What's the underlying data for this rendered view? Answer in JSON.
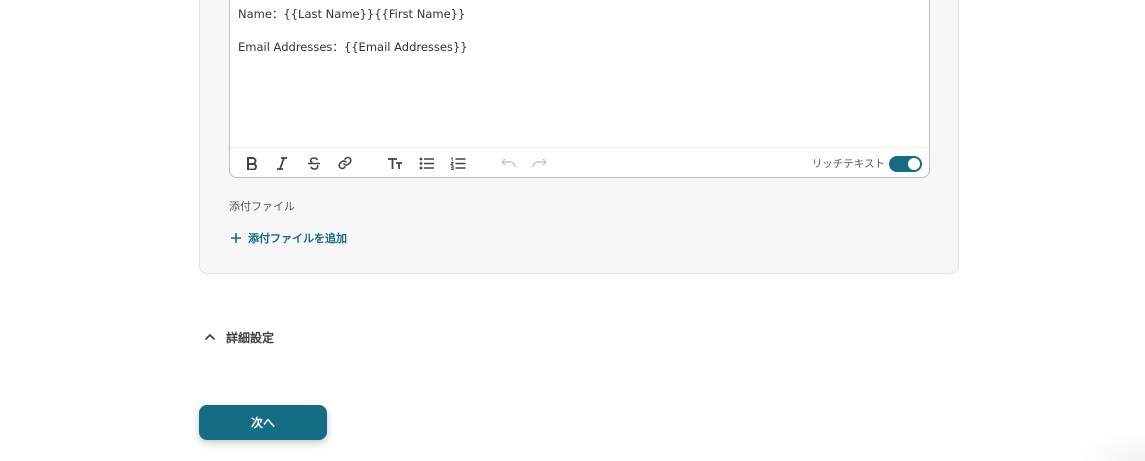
{
  "editor": {
    "lines": [
      "Name：{{Last Name}}{{First Name}}",
      "",
      "Email Addresses：{{Email Addresses}}"
    ],
    "rich_text_label": "リッチテキスト",
    "rich_text_enabled": true,
    "toolbar_icons": [
      "bold-icon",
      "italic-icon",
      "strikethrough-icon",
      "link-icon",
      "text-size-icon",
      "bullet-list-icon",
      "numbered-list-icon",
      "undo-icon",
      "redo-icon"
    ]
  },
  "attachments": {
    "label": "添付ファイル",
    "add_label": "添付ファイルを追加"
  },
  "advanced_settings": {
    "label": "詳細設定",
    "expanded": true
  },
  "next_button": {
    "label": "次へ"
  },
  "colors": {
    "accent": "#146c85",
    "card_bg": "#f7f7f7",
    "border": "#bdbdbd"
  }
}
